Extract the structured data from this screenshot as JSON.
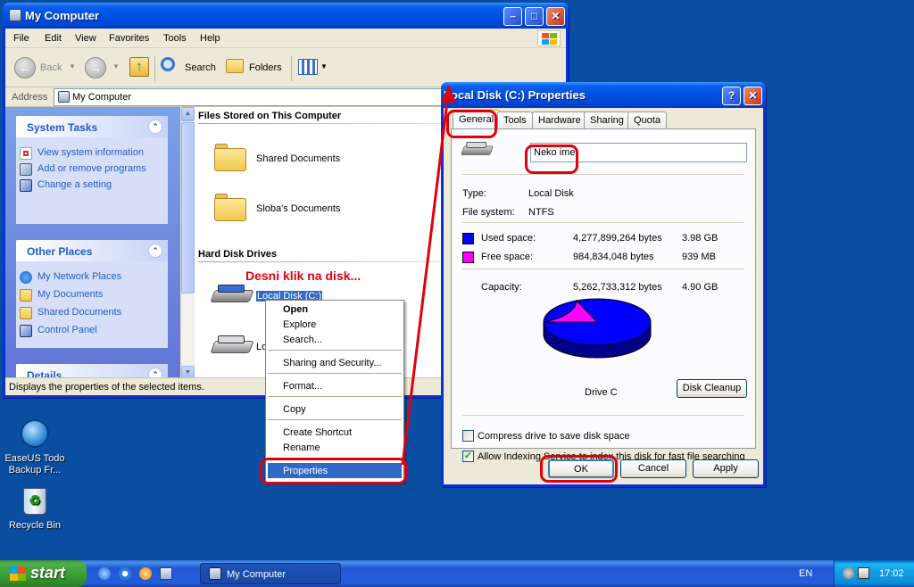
{
  "explorer": {
    "title": "My Computer",
    "menu": [
      "File",
      "Edit",
      "View",
      "Favorites",
      "Tools",
      "Help"
    ],
    "toolbar": {
      "back": "Back",
      "search": "Search",
      "folders": "Folders"
    },
    "address_label": "Address",
    "address_value": "My Computer",
    "system_tasks": {
      "title": "System Tasks",
      "items": [
        "View system information",
        "Add or remove programs",
        "Change a setting"
      ]
    },
    "other_places": {
      "title": "Other Places",
      "items": [
        "My Network Places",
        "My Documents",
        "Shared Documents",
        "Control Panel"
      ]
    },
    "details_title": "Details",
    "files_group": "Files Stored on This Computer",
    "folders": [
      "Shared Documents",
      "Sloba's Documents"
    ],
    "drives_group": "Hard Disk Drives",
    "drives": [
      "Local Disk (C:)",
      "Lo"
    ],
    "status": "Displays the properties of the selected items."
  },
  "context_menu": {
    "open": "Open",
    "explore": "Explore",
    "search": "Search...",
    "sharing": "Sharing and Security...",
    "format": "Format...",
    "copy": "Copy",
    "create_shortcut": "Create Shortcut",
    "rename": "Rename",
    "properties": "Properties"
  },
  "annotation": {
    "hint": "Desni klik na disk..."
  },
  "properties_dialog": {
    "title": "Local Disk (C:) Properties",
    "tabs": [
      "General",
      "Tools",
      "Hardware",
      "Sharing",
      "Quota"
    ],
    "active_tab": "General",
    "label_value": "Neko ime",
    "type_label": "Type:",
    "type_value": "Local Disk",
    "fs_label": "File system:",
    "fs_value": "NTFS",
    "used_label": "Used space:",
    "used_bytes": "4,277,899,264 bytes",
    "used_gb": "3.98 GB",
    "free_label": "Free space:",
    "free_bytes": "984,834,048 bytes",
    "free_gb": "939 MB",
    "capacity_label": "Capacity:",
    "capacity_bytes": "5,262,733,312 bytes",
    "capacity_gb": "4.90 GB",
    "pie": {
      "used_fraction": 0.813,
      "used_color": "#0000ff",
      "free_color": "#ff00ff"
    },
    "drive_label": "Drive C",
    "disk_cleanup": "Disk Cleanup",
    "compress_label": "Compress drive to save disk space",
    "compress_checked": false,
    "index_label": "Allow Indexing Service to index this disk for fast file searching",
    "index_checked": true,
    "ok": "OK",
    "cancel": "Cancel",
    "apply": "Apply"
  },
  "desktop": {
    "icons": [
      {
        "label": "EaseUS Todo Backup Fr..."
      },
      {
        "label": "Recycle Bin"
      }
    ]
  },
  "taskbar": {
    "start": "start",
    "task": "My Computer",
    "lang": "EN",
    "clock": "17:02"
  }
}
